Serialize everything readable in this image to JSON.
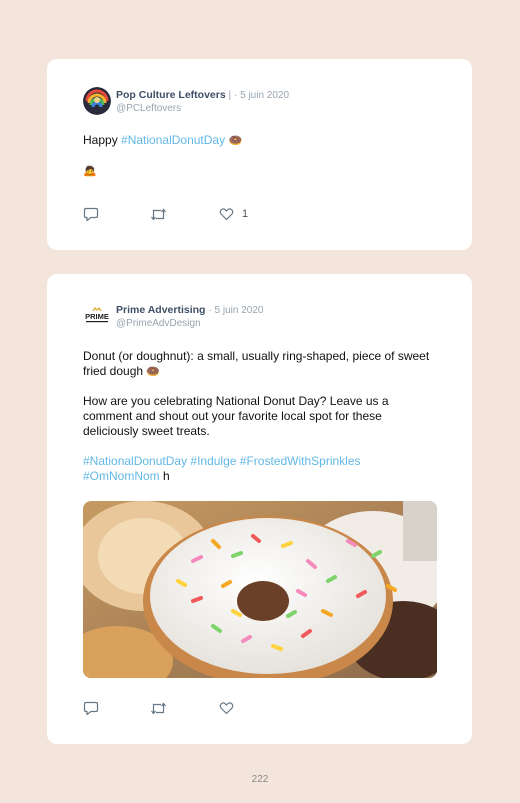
{
  "tweet1": {
    "display_name": "Pop Culture Leftovers",
    "separator": " |",
    "date": "· 5 juin 2020",
    "handle": "@PCLeftovers",
    "text_prefix": "Happy ",
    "hashtag": "#NationalDonutDay",
    "donut_emoji": "🍩",
    "second_line_emoji": "🙇",
    "like_count": "1"
  },
  "tweet2": {
    "display_name": "Prime Advertising",
    "date": "· 5 juin 2020",
    "handle": "@PrimeAdvDesign",
    "logo_text": "PRIME",
    "para1": "Donut (or doughnut): a small, usually ring-shaped, piece of sweet fried dough",
    "donut_emoji": "🍩",
    "para2": "How are you celebrating National Donut Day? Leave us a comment and shout out your favorite local spot for these deliciously sweet treats.",
    "hashtags": [
      "#NationalDonutDay",
      "#Indulge",
      "#FrostedWithSprinkles",
      "#OmNomNom"
    ],
    "trailing_text": " h"
  },
  "page_number": "222",
  "colors": {
    "background": "#f3e5dc",
    "card": "#ffffff",
    "hashtag": "#62b8e6",
    "name": "#3e4f66",
    "muted": "#98a4b0"
  },
  "icons": [
    "reply-icon",
    "retweet-icon",
    "like-icon"
  ]
}
